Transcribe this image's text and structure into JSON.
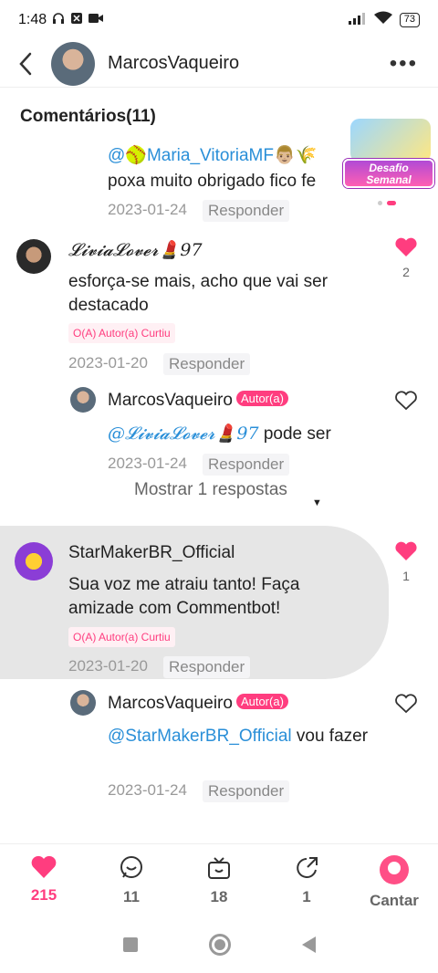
{
  "status_bar": {
    "time": "1:48",
    "battery": "73"
  },
  "header": {
    "title": "MarcosVaqueiro"
  },
  "comments_title": "Comentários(11)",
  "promo": {
    "badge_line1": "Desafio",
    "badge_line2": "Semanal"
  },
  "comments": [
    {
      "mention": "@🥎Maria_VitoriaMF👨🏼🌾",
      "text": "poxa muito obrigado fico fe",
      "date": "2023-01-24",
      "reply": "Responder"
    },
    {
      "name": "𝓛𝓲𝓿𝓲𝓪𝓛𝓸𝓿𝓮𝓻💄97",
      "text": "esforça-se mais, acho que vai ser destacado",
      "liked_by_author": "O(A) Autor(a) Curtiu",
      "date": "2023-01-20",
      "reply": "Responder",
      "likes": "2"
    },
    {
      "name": "MarcosVaqueiro",
      "author_tag": "Autor(a)",
      "mention": "@𝓛𝓲𝓿𝓲𝓪𝓛𝓸𝓿𝓮𝓻💄97",
      "text": " pode ser",
      "date": "2023-01-24",
      "reply": "Responder"
    },
    {
      "name": "StarMakerBR_Official",
      "text": "Sua voz me atraiu tanto! Faça amizade com Commentbot!",
      "liked_by_author": "O(A) Autor(a) Curtiu",
      "date": "2023-01-20",
      "reply": "Responder",
      "likes": "1"
    },
    {
      "name": "MarcosVaqueiro",
      "author_tag": "Autor(a)",
      "mention": "@StarMakerBR_Official",
      "text": " vou fazer",
      "date": "2023-01-24",
      "reply": "Responder"
    }
  ],
  "show_more": "Mostrar 1 respostas",
  "bottom_bar": {
    "likes": "215",
    "comments": "11",
    "gifts": "18",
    "shares": "1",
    "sing": "Cantar"
  },
  "colors": {
    "accent": "#ff3d7f",
    "mention": "#2a8fd8"
  }
}
